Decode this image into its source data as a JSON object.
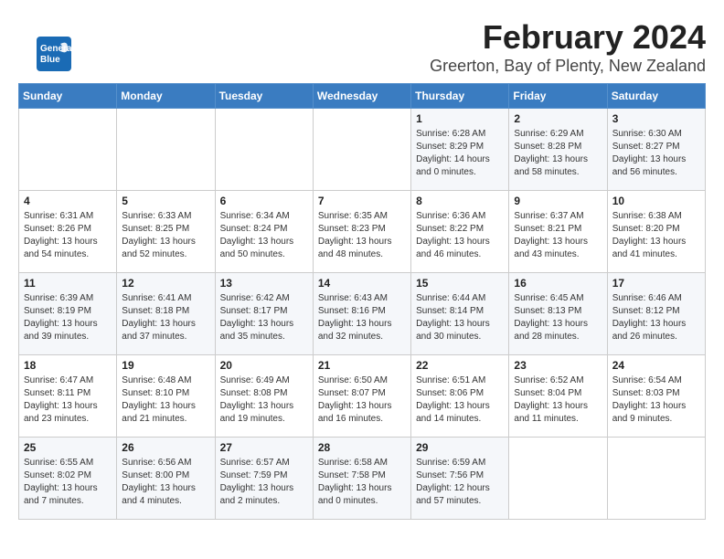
{
  "logo": {
    "line1": "General",
    "line2": "Blue"
  },
  "header": {
    "month": "February 2024",
    "location": "Greerton, Bay of Plenty, New Zealand"
  },
  "weekdays": [
    "Sunday",
    "Monday",
    "Tuesday",
    "Wednesday",
    "Thursday",
    "Friday",
    "Saturday"
  ],
  "weeks": [
    [
      {
        "day": "",
        "info": ""
      },
      {
        "day": "",
        "info": ""
      },
      {
        "day": "",
        "info": ""
      },
      {
        "day": "",
        "info": ""
      },
      {
        "day": "1",
        "info": "Sunrise: 6:28 AM\nSunset: 8:29 PM\nDaylight: 14 hours\nand 0 minutes."
      },
      {
        "day": "2",
        "info": "Sunrise: 6:29 AM\nSunset: 8:28 PM\nDaylight: 13 hours\nand 58 minutes."
      },
      {
        "day": "3",
        "info": "Sunrise: 6:30 AM\nSunset: 8:27 PM\nDaylight: 13 hours\nand 56 minutes."
      }
    ],
    [
      {
        "day": "4",
        "info": "Sunrise: 6:31 AM\nSunset: 8:26 PM\nDaylight: 13 hours\nand 54 minutes."
      },
      {
        "day": "5",
        "info": "Sunrise: 6:33 AM\nSunset: 8:25 PM\nDaylight: 13 hours\nand 52 minutes."
      },
      {
        "day": "6",
        "info": "Sunrise: 6:34 AM\nSunset: 8:24 PM\nDaylight: 13 hours\nand 50 minutes."
      },
      {
        "day": "7",
        "info": "Sunrise: 6:35 AM\nSunset: 8:23 PM\nDaylight: 13 hours\nand 48 minutes."
      },
      {
        "day": "8",
        "info": "Sunrise: 6:36 AM\nSunset: 8:22 PM\nDaylight: 13 hours\nand 46 minutes."
      },
      {
        "day": "9",
        "info": "Sunrise: 6:37 AM\nSunset: 8:21 PM\nDaylight: 13 hours\nand 43 minutes."
      },
      {
        "day": "10",
        "info": "Sunrise: 6:38 AM\nSunset: 8:20 PM\nDaylight: 13 hours\nand 41 minutes."
      }
    ],
    [
      {
        "day": "11",
        "info": "Sunrise: 6:39 AM\nSunset: 8:19 PM\nDaylight: 13 hours\nand 39 minutes."
      },
      {
        "day": "12",
        "info": "Sunrise: 6:41 AM\nSunset: 8:18 PM\nDaylight: 13 hours\nand 37 minutes."
      },
      {
        "day": "13",
        "info": "Sunrise: 6:42 AM\nSunset: 8:17 PM\nDaylight: 13 hours\nand 35 minutes."
      },
      {
        "day": "14",
        "info": "Sunrise: 6:43 AM\nSunset: 8:16 PM\nDaylight: 13 hours\nand 32 minutes."
      },
      {
        "day": "15",
        "info": "Sunrise: 6:44 AM\nSunset: 8:14 PM\nDaylight: 13 hours\nand 30 minutes."
      },
      {
        "day": "16",
        "info": "Sunrise: 6:45 AM\nSunset: 8:13 PM\nDaylight: 13 hours\nand 28 minutes."
      },
      {
        "day": "17",
        "info": "Sunrise: 6:46 AM\nSunset: 8:12 PM\nDaylight: 13 hours\nand 26 minutes."
      }
    ],
    [
      {
        "day": "18",
        "info": "Sunrise: 6:47 AM\nSunset: 8:11 PM\nDaylight: 13 hours\nand 23 minutes."
      },
      {
        "day": "19",
        "info": "Sunrise: 6:48 AM\nSunset: 8:10 PM\nDaylight: 13 hours\nand 21 minutes."
      },
      {
        "day": "20",
        "info": "Sunrise: 6:49 AM\nSunset: 8:08 PM\nDaylight: 13 hours\nand 19 minutes."
      },
      {
        "day": "21",
        "info": "Sunrise: 6:50 AM\nSunset: 8:07 PM\nDaylight: 13 hours\nand 16 minutes."
      },
      {
        "day": "22",
        "info": "Sunrise: 6:51 AM\nSunset: 8:06 PM\nDaylight: 13 hours\nand 14 minutes."
      },
      {
        "day": "23",
        "info": "Sunrise: 6:52 AM\nSunset: 8:04 PM\nDaylight: 13 hours\nand 11 minutes."
      },
      {
        "day": "24",
        "info": "Sunrise: 6:54 AM\nSunset: 8:03 PM\nDaylight: 13 hours\nand 9 minutes."
      }
    ],
    [
      {
        "day": "25",
        "info": "Sunrise: 6:55 AM\nSunset: 8:02 PM\nDaylight: 13 hours\nand 7 minutes."
      },
      {
        "day": "26",
        "info": "Sunrise: 6:56 AM\nSunset: 8:00 PM\nDaylight: 13 hours\nand 4 minutes."
      },
      {
        "day": "27",
        "info": "Sunrise: 6:57 AM\nSunset: 7:59 PM\nDaylight: 13 hours\nand 2 minutes."
      },
      {
        "day": "28",
        "info": "Sunrise: 6:58 AM\nSunset: 7:58 PM\nDaylight: 13 hours\nand 0 minutes."
      },
      {
        "day": "29",
        "info": "Sunrise: 6:59 AM\nSunset: 7:56 PM\nDaylight: 12 hours\nand 57 minutes."
      },
      {
        "day": "",
        "info": ""
      },
      {
        "day": "",
        "info": ""
      }
    ]
  ]
}
